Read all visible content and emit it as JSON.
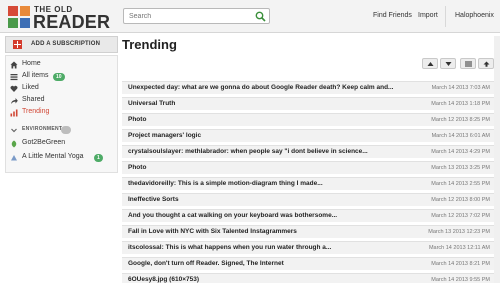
{
  "header": {
    "logo_small": "THE OLD",
    "logo_big": "READER",
    "search_placeholder": "Search",
    "find_friends": "Find Friends",
    "import": "Import",
    "user": "Halophoenix"
  },
  "sidebar": {
    "add_subscription": "ADD A SUBSCRIPTION",
    "items": [
      {
        "label": "Home",
        "icon": "home-icon"
      },
      {
        "label": "All items",
        "icon": "list-icon",
        "badge": "10"
      },
      {
        "label": "Liked",
        "icon": "heart-icon"
      },
      {
        "label": "Shared",
        "icon": "share-icon"
      },
      {
        "label": "Trending",
        "icon": "trending-icon",
        "active": true
      }
    ],
    "folder": {
      "label": "ENVIRONMENT",
      "badge": ""
    },
    "feeds": [
      {
        "label": "Got2BeGreen",
        "icon": "feed-icon"
      },
      {
        "label": "A Little Mental Yoga",
        "icon": "feed-icon",
        "badge": "1"
      }
    ]
  },
  "main": {
    "title": "Trending",
    "items": [
      {
        "title": "Unexpected day: what are we gonna do about Google Reader death? Keep calm and...",
        "date": "March 14 2013 7:03 AM"
      },
      {
        "title": "Universal Truth",
        "date": "March 14 2013 1:18 PM"
      },
      {
        "title": "Photo",
        "date": "March 12 2013 8:25 PM"
      },
      {
        "title": "Project managers' logic",
        "date": "March 14 2013 6:01 AM"
      },
      {
        "title": "crystalsoulslayer: methlabrador: when people say \"i dont believe in science...",
        "date": "March 14 2013 4:29 PM"
      },
      {
        "title": "Photo",
        "date": "March 13 2013 3:25 PM"
      },
      {
        "title": "thedavidoreilly: This is a simple motion-diagram thing I made...",
        "date": "March 14 2013 2:55 PM"
      },
      {
        "title": "Ineffective Sorts",
        "date": "March 12 2013 8:00 PM"
      },
      {
        "title": "And you thought a cat walking on your keyboard was bothersome...",
        "date": "March 12 2013 7:02 PM"
      },
      {
        "title": "Fall in Love with NYC with Six Talented Instagrammers",
        "date": "March 13 2013 12:23 PM"
      },
      {
        "title": "itscolossal: This is what happens when you run water through a...",
        "date": "March 14 2013 12:11 AM"
      },
      {
        "title": "Google, don't turn off Reader. Signed, The Internet",
        "date": "March 14 2013 8:21 PM"
      },
      {
        "title": "6OUesy8.jpg (610×753)",
        "date": "March 14 2013 9:55 PM"
      }
    ]
  },
  "colors": {
    "accent": "#d14836",
    "badge": "#4eab67",
    "search_icon": "#3a8f3a"
  }
}
